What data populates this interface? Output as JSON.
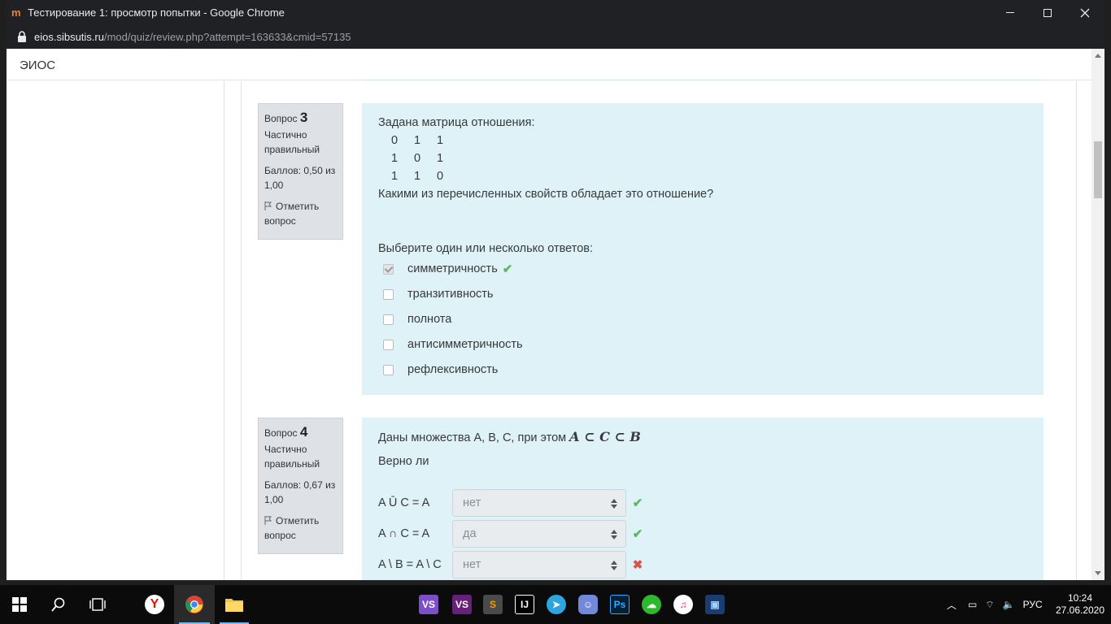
{
  "window": {
    "title": "Тестирование 1: просмотр попытки - Google Chrome",
    "url_host": "eios.sibsutis.ru",
    "url_path": "/mod/quiz/review.php?attempt=163633&cmid=57135"
  },
  "site": {
    "brand": "ЭИОС"
  },
  "q3": {
    "label": "Вопрос",
    "number": "3",
    "state": "Частично правильный",
    "grade": "Баллов: 0,50 из 1,00",
    "flag": "Отметить вопрос",
    "intro": "Задана матрица отношения:",
    "matrix": [
      [
        "0",
        "1",
        "1"
      ],
      [
        "1",
        "0",
        "1"
      ],
      [
        "1",
        "1",
        "0"
      ]
    ],
    "question": "Какими из перечисленных свойств обладает это отношение?",
    "prompt": "Выберите один или несколько ответов:",
    "options": [
      {
        "label": "симметричность",
        "checked": true,
        "mark": "✔"
      },
      {
        "label": "транзитивность",
        "checked": false
      },
      {
        "label": "полнота",
        "checked": false
      },
      {
        "label": "антисимметричность",
        "checked": false
      },
      {
        "label": "рефлексивность",
        "checked": false
      }
    ]
  },
  "q4": {
    "label": "Вопрос",
    "number": "4",
    "state": "Частично правильный",
    "grade": "Баллов: 0,67 из 1,00",
    "flag": "Отметить вопрос",
    "intro": "Даны множества A, B, C, при этом",
    "formula": "A ⊂ C ⊂ B",
    "question": "Верно ли",
    "rows": [
      {
        "label": "A Ū C = A",
        "value": "нет",
        "mark": "✔",
        "correct": true
      },
      {
        "label": "A ∩ C = A",
        "value": "да",
        "mark": "✔",
        "correct": true
      },
      {
        "label": "A \\ B = A \\ C",
        "value": "нет",
        "mark": "✖",
        "correct": false
      }
    ]
  },
  "taskbar": {
    "language": "РУС",
    "time": "10:24",
    "date": "27.06.2020"
  },
  "colors": {
    "question_bg": "#def2f8",
    "info_bg": "#dee2e6",
    "correct": "#5cb85c",
    "incorrect": "#d9534f"
  }
}
